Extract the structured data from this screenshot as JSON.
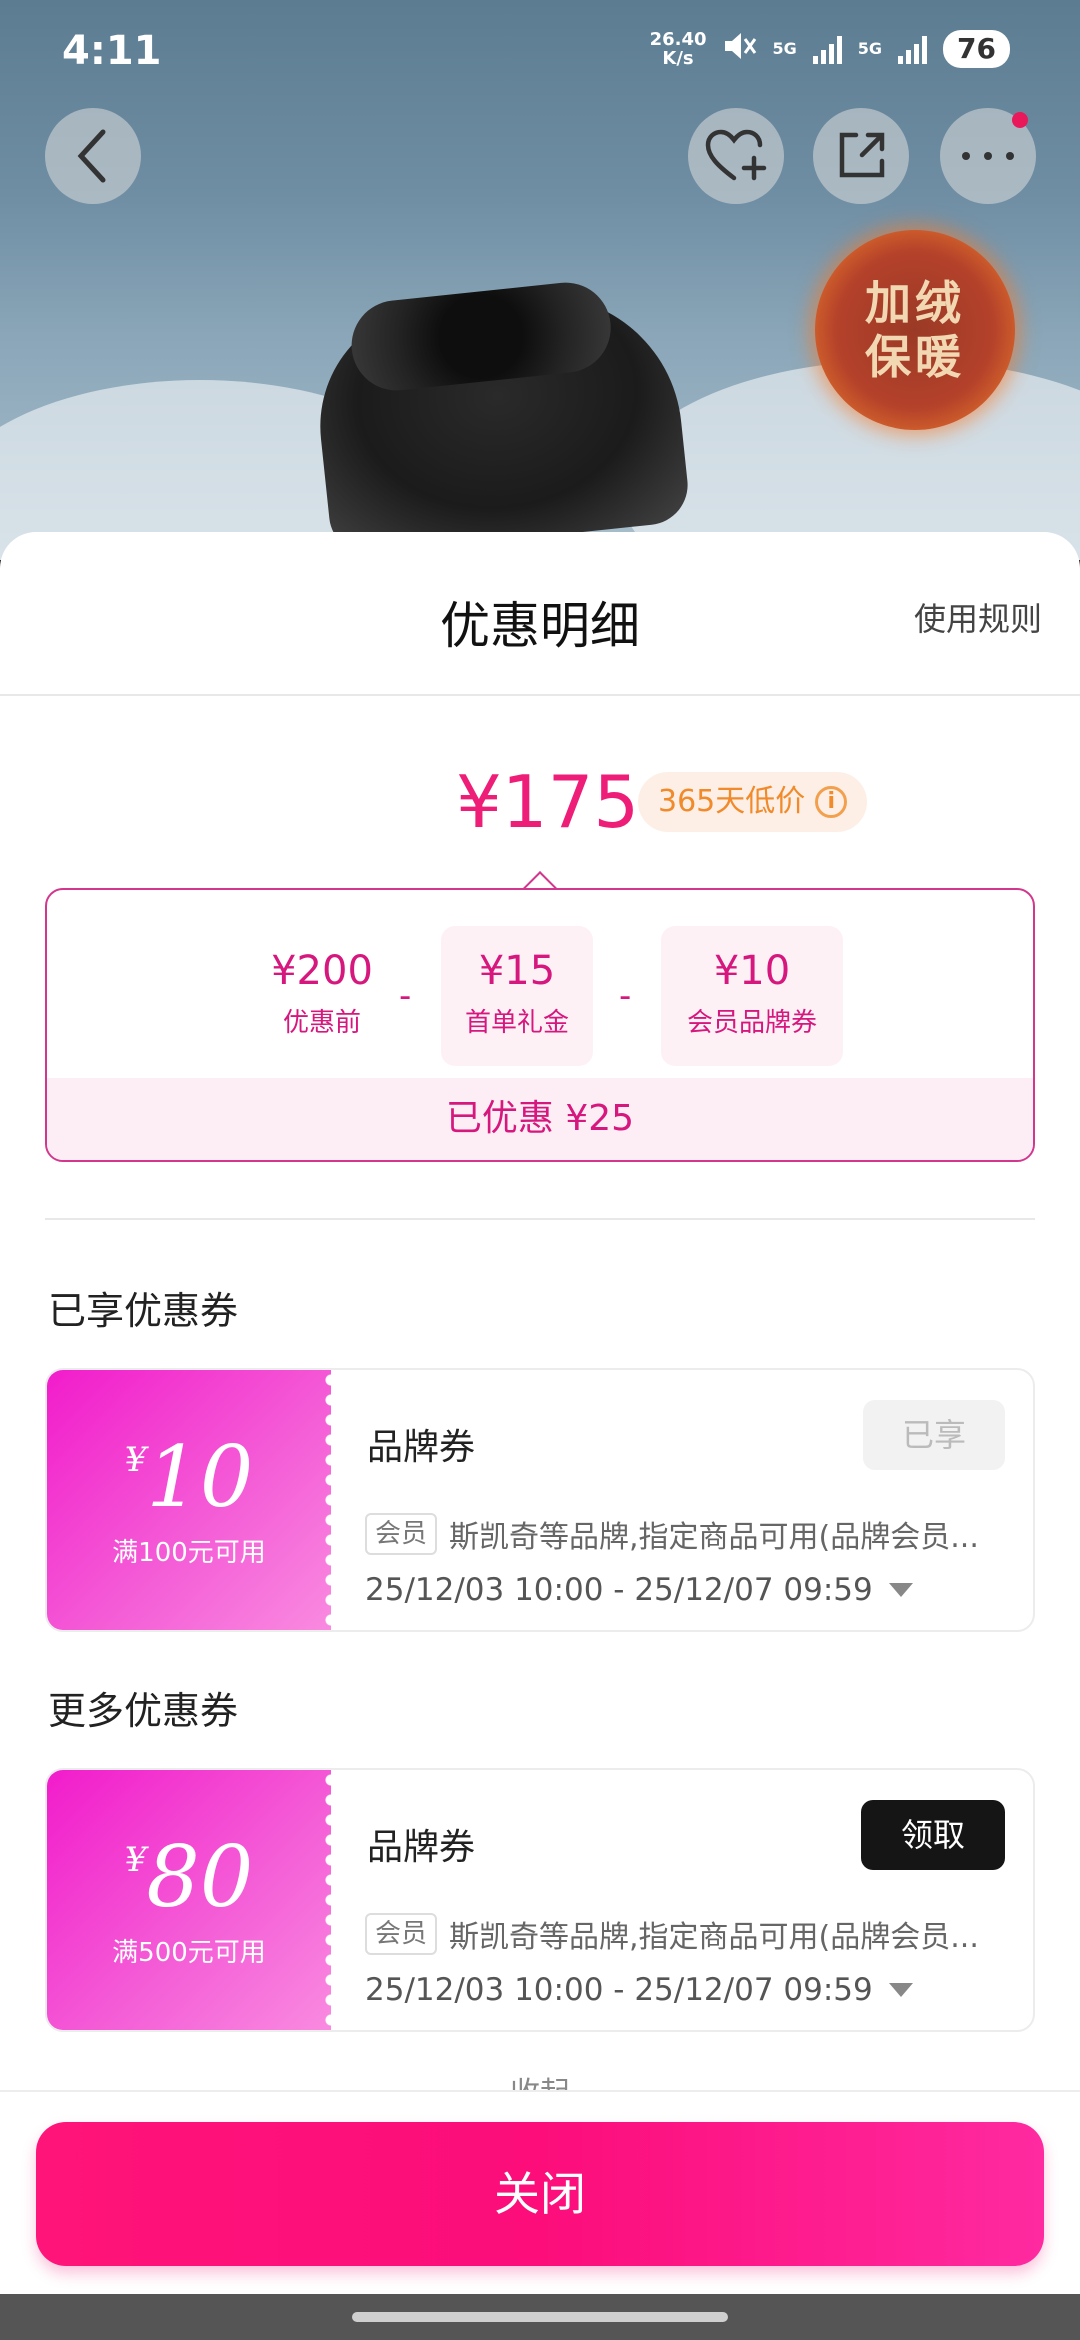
{
  "status_bar": {
    "time": "4:11",
    "net_speed": "26.40",
    "net_unit": "K/s",
    "net_type_1": "5G",
    "net_type_2": "5G",
    "battery": "76"
  },
  "product_image": {
    "badge_line1": "加绒",
    "badge_line2": "保暖"
  },
  "top_nav": {
    "icons": [
      "back-icon",
      "favorite-add-icon",
      "share-icon",
      "more-icon"
    ]
  },
  "sheet": {
    "title": "优惠明细",
    "rules_link": "使用规则",
    "final_price": "¥175",
    "low_price_badge": "365天低价",
    "breakdown": [
      {
        "amount": "¥200",
        "label": "优惠前"
      },
      {
        "amount": "¥15",
        "label": "首单礼金"
      },
      {
        "amount": "¥10",
        "label": "会员品牌券"
      }
    ],
    "operator": "-",
    "saved_text": "已优惠 ¥25",
    "section_enjoyed": "已享优惠券",
    "section_more": "更多优惠券",
    "coupons_enjoyed": [
      {
        "currency": "¥",
        "amount": "10",
        "condition": "满100元可用",
        "type": "品牌券",
        "tag": "会员",
        "desc": "斯凯奇等品牌,指定商品可用(品牌会员...",
        "validity": "25/12/03 10:00 - 25/12/07 09:59",
        "action": "已享"
      }
    ],
    "coupons_more": [
      {
        "currency": "¥",
        "amount": "80",
        "condition": "满500元可用",
        "type": "品牌券",
        "tag": "会员",
        "desc": "斯凯奇等品牌,指定商品可用(品牌会员...",
        "validity": "25/12/03 10:00 - 25/12/07 09:59",
        "action": "领取"
      }
    ],
    "collapse_hint": "收起",
    "close_button": "关闭"
  },
  "colors": {
    "accent": "#ee1e78",
    "coupon_gradient_start": "#f21ccb",
    "close_button": "#ff1479"
  }
}
